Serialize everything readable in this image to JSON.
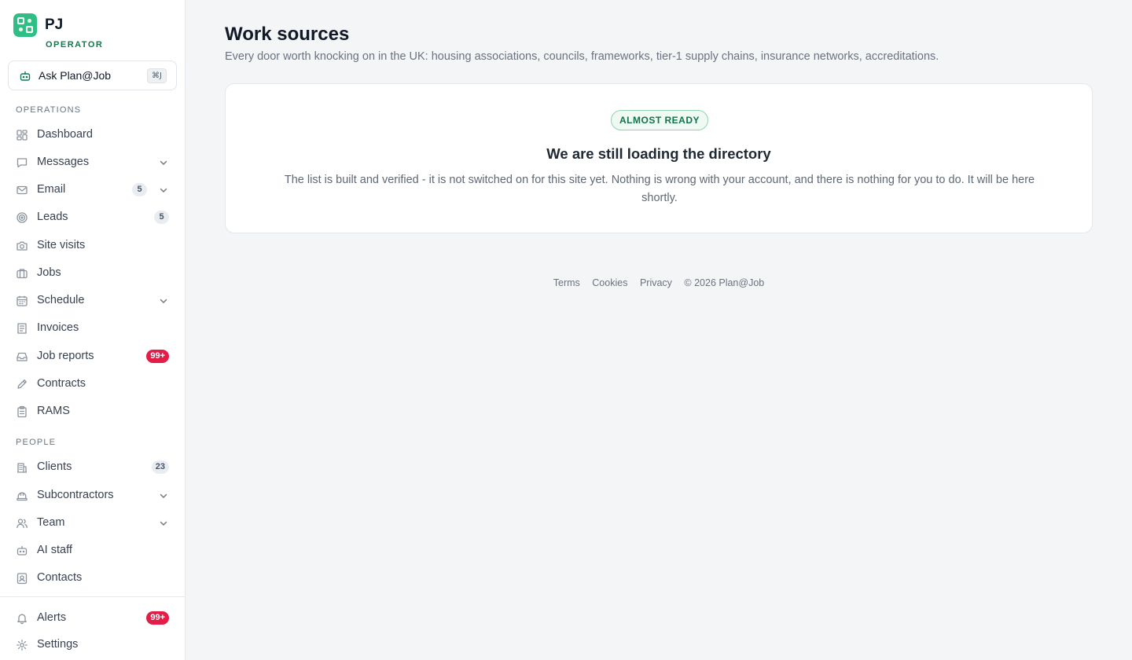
{
  "brand": {
    "initials": "PJ",
    "role": "OPERATOR"
  },
  "ask": {
    "label": "Ask Plan@Job",
    "shortcut": "⌘J"
  },
  "sidebar": {
    "sections": [
      "OPERATIONS",
      "PEOPLE"
    ],
    "items": [
      {
        "label": "Dashboard",
        "icon": "grid-icon"
      },
      {
        "label": "Messages",
        "icon": "chat-icon",
        "expandable": true
      },
      {
        "label": "Email",
        "icon": "mail-icon",
        "badge": "5",
        "expandable": true
      },
      {
        "label": "Leads",
        "icon": "target-icon",
        "badge": "5"
      },
      {
        "label": "Site visits",
        "icon": "camera-icon"
      },
      {
        "label": "Jobs",
        "icon": "briefcase-icon"
      },
      {
        "label": "Schedule",
        "icon": "calendar-icon",
        "expandable": true
      },
      {
        "label": "Invoices",
        "icon": "document-icon"
      },
      {
        "label": "Job reports",
        "icon": "inbox-icon",
        "badge": "99+"
      },
      {
        "label": "Contracts",
        "icon": "pen-icon"
      },
      {
        "label": "RAMS",
        "icon": "clipboard-icon"
      },
      {
        "label": "Clients",
        "icon": "building-icon",
        "badge": "23"
      },
      {
        "label": "Subcontractors",
        "icon": "hardhat-icon",
        "expandable": true
      },
      {
        "label": "Team",
        "icon": "users-icon",
        "expandable": true
      },
      {
        "label": "AI staff",
        "icon": "bot-icon"
      },
      {
        "label": "Contacts",
        "icon": "contact-card-icon"
      },
      {
        "label": "Alerts",
        "icon": "bell-icon",
        "badge": "99+"
      },
      {
        "label": "Settings",
        "icon": "gear-icon"
      }
    ]
  },
  "main": {
    "title": "Work sources",
    "subtitle": "Every door worth knocking on in the UK: housing associations, councils, frameworks, tier-1 supply chains, insurance networks, accreditations.",
    "card": {
      "status": "ALMOST READY",
      "heading": "We are still loading the directory",
      "body": "The list is built and verified - it is not switched on for this site yet. Nothing is wrong with your account, and there is nothing for you to do. It will be here shortly."
    }
  },
  "footer": {
    "links": [
      "Terms",
      "Cookies",
      "Privacy"
    ],
    "copyright": "© 2026 Plan@Job"
  },
  "colors": {
    "accent": "#2fbf85",
    "accent_dark": "#0f7a4e",
    "badge_red": "#e11d48",
    "background": "#f3f5f7"
  }
}
